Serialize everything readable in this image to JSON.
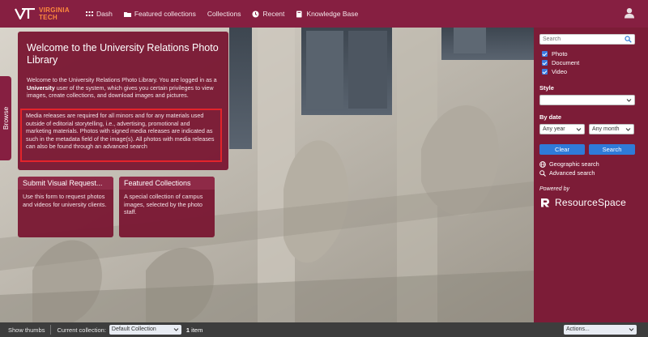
{
  "header": {
    "logo_text_line1": "VIRGINIA",
    "logo_text_line2": "TECH",
    "nav": [
      {
        "label": "Dash",
        "icon": "grid-icon"
      },
      {
        "label": "Featured collections",
        "icon": "folder-icon"
      },
      {
        "label": "Collections",
        "icon": "folder-icon"
      },
      {
        "label": "Recent",
        "icon": "clock-icon"
      },
      {
        "label": "Knowledge Base",
        "icon": "book-icon"
      }
    ],
    "user_icon": "user-icon"
  },
  "browse_tab": {
    "label": "Browse"
  },
  "welcome": {
    "title": "Welcome to the University Relations Photo Library",
    "intro_before": "Welcome to the University Relations Photo Library. You are logged in as a ",
    "intro_bold": "University",
    "intro_after": " user of the system, which gives you certain privileges to view images, create collections, and download images and pictures.",
    "media_release": "Media releases are required for all minors and for any materials used outside of editorial storytelling, i.e., advertising, promotional and marketing materials. Photos with signed media releases are indicated as such in the metadata field of the image(s). All photos with media releases can also be found through an advanced search"
  },
  "tiles": [
    {
      "title": "Submit Visual Request...",
      "body": "Use this form to request photos and videos for university clients."
    },
    {
      "title": "Featured Collections",
      "body": "A special collection of campus images, selected by the photo staff."
    }
  ],
  "sidebar": {
    "search_placeholder": "Search",
    "resource_types": [
      {
        "label": "Photo",
        "checked": true
      },
      {
        "label": "Document",
        "checked": true
      },
      {
        "label": "Video",
        "checked": true
      }
    ],
    "style_label": "Style",
    "style_value": "",
    "by_date_label": "By date",
    "year_value": "Any year",
    "month_value": "Any month",
    "clear_label": "Clear",
    "search_label": "Search",
    "geographic_search": "Geographic search",
    "advanced_search": "Advanced search",
    "powered_by": "Powered by",
    "resourcespace": "ResourceSpace"
  },
  "bottom_bar": {
    "show_thumbs": "Show thumbs",
    "current_collection_label": "Current collection:",
    "collection_value": "Default Collection",
    "count_number": "1",
    "count_unit": "item",
    "actions": "Actions..."
  },
  "colors": {
    "maroon": "#861f41",
    "panel": "#7a1833",
    "orange": "#ff8a3d",
    "button_blue": "#2f7bd8",
    "highlight_red": "#e3242b"
  }
}
